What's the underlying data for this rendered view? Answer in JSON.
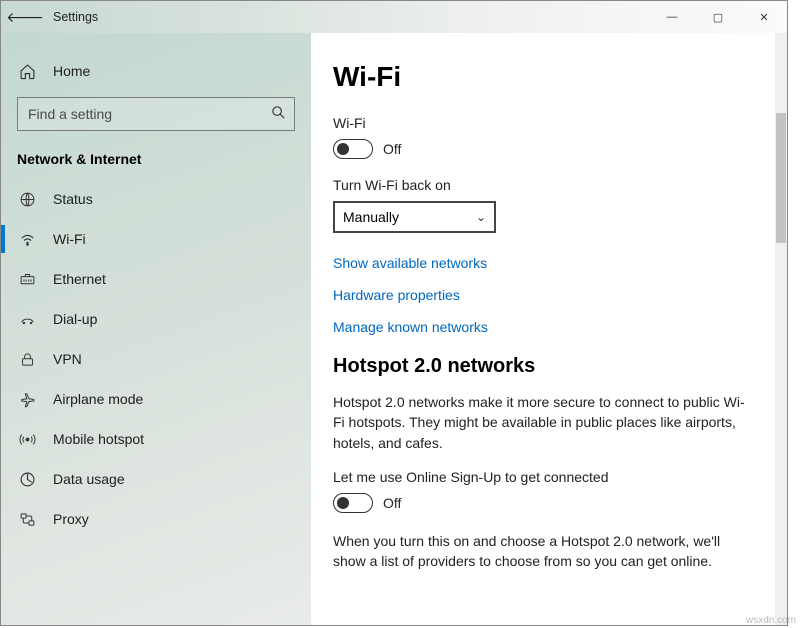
{
  "window": {
    "title": "Settings"
  },
  "sidebar": {
    "home_label": "Home",
    "search_placeholder": "Find a setting",
    "category": "Network & Internet",
    "items": [
      {
        "label": "Status"
      },
      {
        "label": "Wi-Fi"
      },
      {
        "label": "Ethernet"
      },
      {
        "label": "Dial-up"
      },
      {
        "label": "VPN"
      },
      {
        "label": "Airplane mode"
      },
      {
        "label": "Mobile hotspot"
      },
      {
        "label": "Data usage"
      },
      {
        "label": "Proxy"
      }
    ]
  },
  "main": {
    "heading": "Wi-Fi",
    "wifi_label": "Wi-Fi",
    "wifi_state": "Off",
    "turn_back_label": "Turn Wi-Fi back on",
    "turn_back_value": "Manually",
    "link_available": "Show available networks",
    "link_hardware": "Hardware properties",
    "link_known": "Manage known networks",
    "hotspot_heading": "Hotspot 2.0 networks",
    "hotspot_desc": "Hotspot 2.0 networks make it more secure to connect to public Wi-Fi hotspots. They might be available in public places like airports, hotels, and cafes.",
    "signup_label": "Let me use Online Sign-Up to get connected",
    "signup_state": "Off",
    "signup_desc": "When you turn this on and choose a Hotspot 2.0 network, we'll show a list of providers to choose from so you can get online."
  },
  "watermark": "wsxdn.com"
}
